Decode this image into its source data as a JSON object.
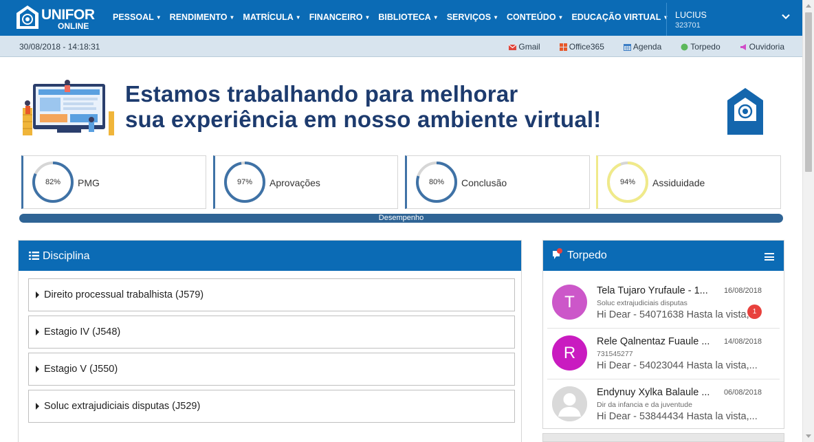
{
  "nav": {
    "logo_text": "UNIFOR",
    "logo_sub": "ONLINE",
    "menu": [
      "PESSOAL",
      "RENDIMENTO",
      "MATRÍCULA",
      "FINANCEIRO",
      "BIBLIOTECA",
      "SERVIÇOS",
      "CONTEÚDO",
      "EDUCAÇÃO VIRTUAL"
    ],
    "user": {
      "name": "LUCIUS",
      "id": "323701"
    }
  },
  "subbar": {
    "datetime": "30/08/2018 - 14:18:31",
    "links": [
      {
        "label": "Gmail",
        "icon": "mail-icon",
        "color": "#e0453b"
      },
      {
        "label": "Office365",
        "icon": "office-icon",
        "color": "#e8582a"
      },
      {
        "label": "Agenda",
        "icon": "calendar-icon",
        "color": "#3a7cc4"
      },
      {
        "label": "Torpedo",
        "icon": "dot-icon",
        "color": "#5cb85c"
      },
      {
        "label": "Ouvidoria",
        "icon": "megaphone-icon",
        "color": "#d04dc8"
      }
    ]
  },
  "banner": {
    "line1": "Estamos trabalhando para melhorar",
    "line2": "sua experiência em nosso ambiente virtual!"
  },
  "stats": [
    {
      "label": "PMG",
      "value": 82,
      "display": "82%",
      "color": "#3f72a6"
    },
    {
      "label": "Aprovações",
      "value": 97,
      "display": "97%",
      "color": "#3f72a6"
    },
    {
      "label": "Conclusão",
      "value": 80,
      "display": "80%",
      "color": "#3f72a6"
    },
    {
      "label": "Assiduidade",
      "value": 94,
      "display": "94%",
      "color": "#f0ea8a"
    }
  ],
  "performance_label": "Desempenho",
  "disciplina": {
    "title": "Disciplina",
    "items": [
      "Direito processual trabalhista (J579)",
      "Estagio IV (J548)",
      "Estagio V (J550)",
      "Soluc extrajudiciais disputas (J529)"
    ]
  },
  "torpedo": {
    "title": "Torpedo",
    "messages": [
      {
        "avatar": "T",
        "avatar_color": "#cc57c9",
        "sender": "Tela Tujaro Yrufaule - 1...",
        "date": "16/08/2018",
        "subject": "Soluc extrajudiciais disputas",
        "body": "Hi Dear - 54071638 Hasta la vista,...",
        "badge": "1"
      },
      {
        "avatar": "R",
        "avatar_color": "#c91bc0",
        "sender": "Rele Qalnentaz Fuaule ...",
        "date": "14/08/2018",
        "subject": "731545277",
        "body": "Hi Dear - 54023044 Hasta la vista,...",
        "badge": ""
      },
      {
        "avatar": "",
        "avatar_color": "#d9d9d9",
        "sender": "Endynuy Xylka Balaule ...",
        "date": "06/08/2018",
        "subject": "Dir da infancia e da juventude",
        "body": "Hi Dear - 53844434 Hasta la vista,...",
        "badge": ""
      }
    ]
  }
}
